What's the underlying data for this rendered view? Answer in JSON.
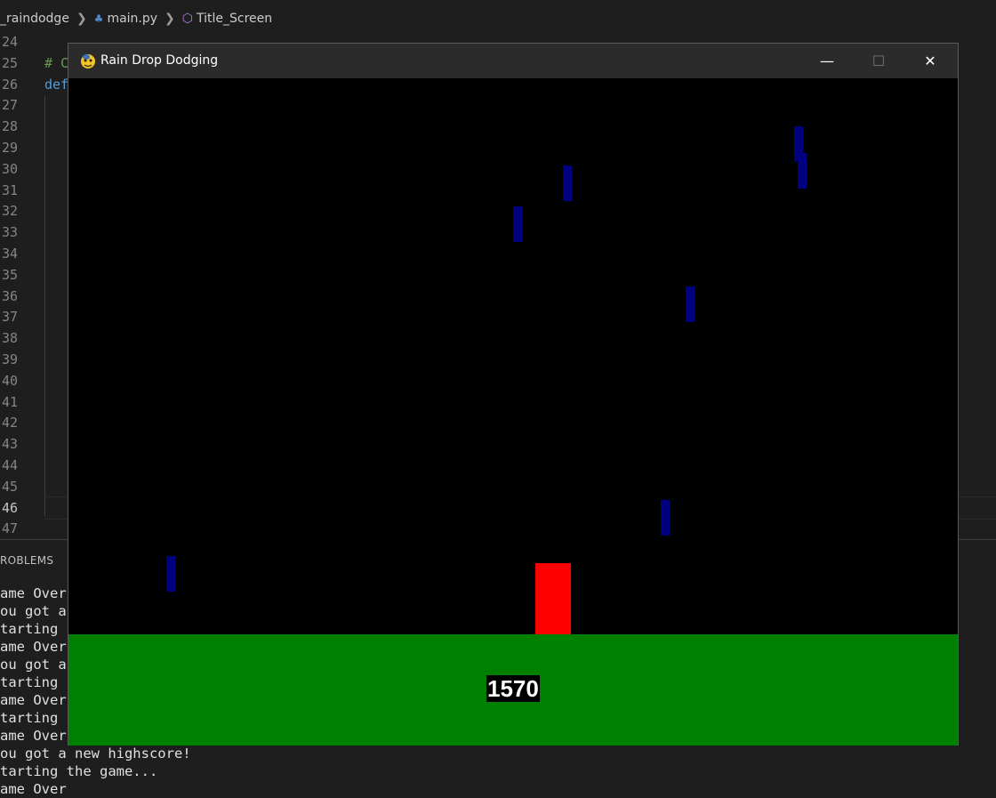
{
  "breadcrumb": {
    "folder": "_raindodge",
    "file": "main.py",
    "symbol": "Title_Screen"
  },
  "editor": {
    "lines": [
      {
        "num": "24",
        "code": ""
      },
      {
        "num": "25",
        "code": "# C"
      },
      {
        "num": "26",
        "code": "def"
      },
      {
        "num": "27",
        "code": ""
      },
      {
        "num": "28",
        "code": ""
      },
      {
        "num": "29",
        "code": ""
      },
      {
        "num": "30",
        "code": ""
      },
      {
        "num": "31",
        "code": ""
      },
      {
        "num": "32",
        "code": ""
      },
      {
        "num": "33",
        "code": ""
      },
      {
        "num": "34",
        "code": ""
      },
      {
        "num": "35",
        "code": ""
      },
      {
        "num": "36",
        "code": ""
      },
      {
        "num": "37",
        "code": ""
      },
      {
        "num": "38",
        "code": ""
      },
      {
        "num": "39",
        "code": ""
      },
      {
        "num": "40",
        "code": ""
      },
      {
        "num": "41",
        "code": ""
      },
      {
        "num": "42",
        "code": ""
      },
      {
        "num": "43",
        "code": ""
      },
      {
        "num": "44",
        "code": ""
      },
      {
        "num": "45",
        "code": ""
      },
      {
        "num": "46",
        "code": ""
      },
      {
        "num": "47",
        "code": ""
      }
    ]
  },
  "panel": {
    "tab_label": "ROBLEMS",
    "terminal_lines": [
      "ame Over",
      "ou got a",
      "tarting",
      "ame Over",
      "ou got a",
      "tarting",
      "ame Over",
      "tarting",
      "ame Over",
      "ou got a new highscore!",
      "tarting the game...",
      "ame Over"
    ]
  },
  "window": {
    "title": "Rain Drop Dodging",
    "minimize": "—",
    "maximize": "☐",
    "close": "✕",
    "score": "1570",
    "colors": {
      "drop": "#000080",
      "player": "#ff0000",
      "ground": "#008000",
      "background": "#000000"
    }
  }
}
